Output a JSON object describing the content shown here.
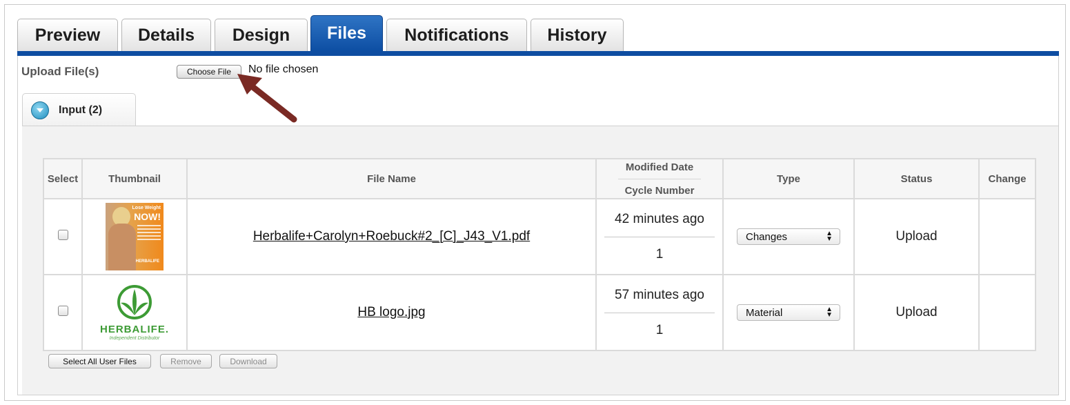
{
  "tabs": [
    "Preview",
    "Details",
    "Design",
    "Files",
    "Notifications",
    "History"
  ],
  "active_tab": "Files",
  "upload": {
    "label": "Upload File(s)",
    "choose_button": "Choose File",
    "no_file_text": "No file chosen"
  },
  "subtab": {
    "label": "Input (2)"
  },
  "table": {
    "headers": {
      "select": "Select",
      "thumbnail": "Thumbnail",
      "file_name": "File Name",
      "modified_date": "Modified Date",
      "cycle_number": "Cycle Number",
      "type": "Type",
      "status": "Status",
      "change": "Change"
    },
    "rows": [
      {
        "file_name": "Herbalife+Carolyn+Roebuck#2_[C]_J43_V1.pdf",
        "modified": "42 minutes ago",
        "cycle": "1",
        "type": "Changes",
        "status": "Upload",
        "thumb": {
          "kind": "flyer",
          "text_top": "Lose Weight",
          "text_big": "NOW!",
          "text_brand": "HERBALIFE"
        }
      },
      {
        "file_name": "HB logo.jpg",
        "modified": "57 minutes ago",
        "cycle": "1",
        "type": "Material",
        "status": "Upload",
        "thumb": {
          "kind": "logo",
          "brand": "HERBALIFE.",
          "sub": "Independent Distributor"
        }
      }
    ]
  },
  "actions": {
    "select_all": "Select All User Files",
    "remove": "Remove",
    "download": "Download"
  },
  "colors": {
    "tab_active": "#0e4da1",
    "annotation_arrow": "#7a2a24",
    "logo_green": "#3d9b35"
  }
}
